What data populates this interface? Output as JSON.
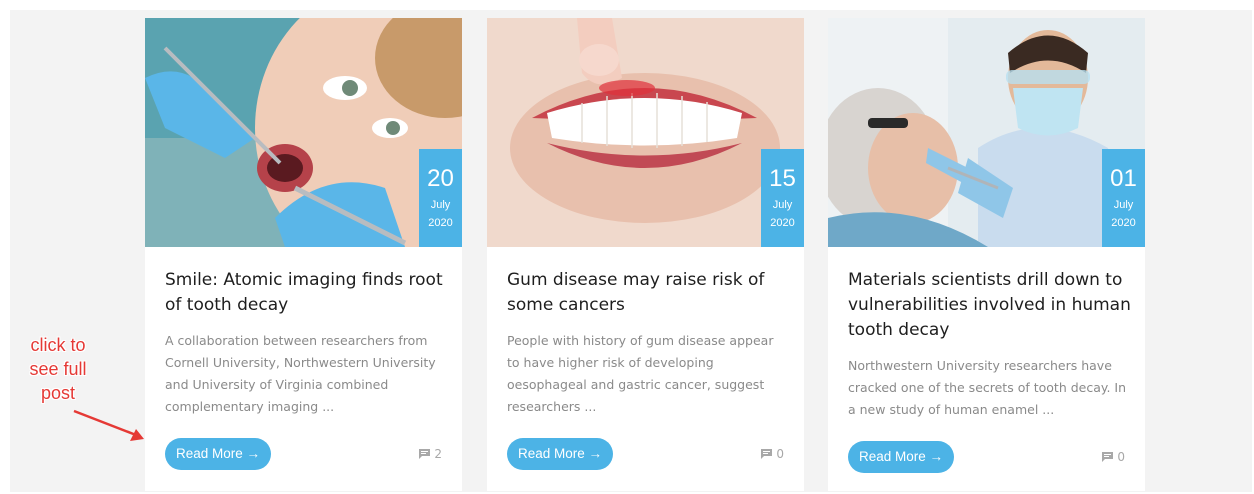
{
  "posts": [
    {
      "day": "20",
      "month": "July",
      "year": "2020",
      "title": "Smile: Atomic imaging finds root of tooth decay",
      "excerpt": "A collaboration between researchers from Cornell University, Northwestern University and University of Virginia combined complementary imaging ...",
      "read_more": "Read More →",
      "comments": "2",
      "image_icon": "dental-exam-photo"
    },
    {
      "day": "15",
      "month": "July",
      "year": "2020",
      "title": "Gum disease may raise risk of some cancers",
      "excerpt": "People with history of gum disease appear to have higher risk of developing oesophageal and gastric cancer, suggest researchers ...",
      "read_more": "Read More →",
      "comments": "0",
      "image_icon": "gum-closeup-photo"
    },
    {
      "day": "01",
      "month": "July",
      "year": "2020",
      "title": "Materials scientists drill down to vulnerabilities involved in human tooth decay",
      "excerpt": "Northwestern University researchers have cracked one of the secrets of tooth decay. In a new study of human enamel ...",
      "read_more": "Read More →",
      "comments": "0",
      "image_icon": "dentist-patient-photo"
    }
  ],
  "annotation": {
    "text": "click to see full post"
  },
  "colors": {
    "accent": "#4cb3e6",
    "annotation": "#e53935",
    "title": "#1e1e1e",
    "excerpt": "#8a8a8a"
  }
}
